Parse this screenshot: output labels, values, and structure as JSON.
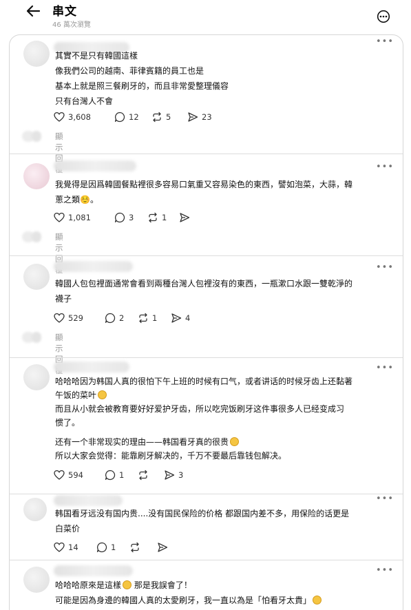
{
  "header": {
    "title": "串文",
    "views": "46 萬次瀏覽"
  },
  "posts": [
    {
      "lines": [
        "其實不是只有韓國這樣",
        "像我們公司的越南、菲律賓籍的員工也是",
        "基本上就是照三餐刷牙的，而且非常愛整理儀容",
        "只有台灣人不會"
      ],
      "likes": "3,608",
      "comments": "12",
      "reposts": "5",
      "shares": "23",
      "reply_label": "顯示回覆"
    },
    {
      "lines": [
        "我覺得是因爲韓國餐點裡很多容易口氣重又容易染色的東西，譬如泡菜，大蒜，韓",
        "蔥之類☺️。"
      ],
      "likes": "1,081",
      "comments": "3",
      "reposts": "1",
      "shares": "",
      "reply_label": "顯示回覆"
    },
    {
      "lines": [
        "韓國人包包裡面通常會看到兩種台灣人包裡沒有的東西，一瓶漱口水跟一雙乾淨的",
        "襪子"
      ],
      "likes": "529",
      "comments": "2",
      "reposts": "1",
      "shares": "4",
      "reply_label": "顯示回覆"
    },
    {
      "lines": [
        "哈哈哈因为韩国人真的很怕下午上班的时候有口气，或者讲话的时候牙齿上还黏著",
        "午饭的菜叶",
        "而且从小就会被教育要好好爱护牙齿，所以吃完饭刷牙这件事很多人已经变成习",
        "惯了。",
        "还有一个非常现实的理由——韩国看牙真的很贵",
        "所以大家会觉得：能靠刷牙解决的，千万不要最后靠钱包解决。"
      ],
      "likes": "594",
      "comments": "1",
      "reposts": "",
      "shares": "3"
    },
    {
      "lines": [
        "韩国看牙远没有国内贵....没有国民保险的价格 都跟国内差不多，用保险的话更是",
        "白菜价"
      ],
      "likes": "14",
      "comments": "1",
      "reposts": "",
      "shares": ""
    },
    {
      "lines": [
        "哈哈哈原來是這樣",
        " 那是我誤會了！",
        "可能是因為身邊的韓國人真的太愛刷牙，我一直以為是「怕看牙太貴」"
      ]
    }
  ]
}
